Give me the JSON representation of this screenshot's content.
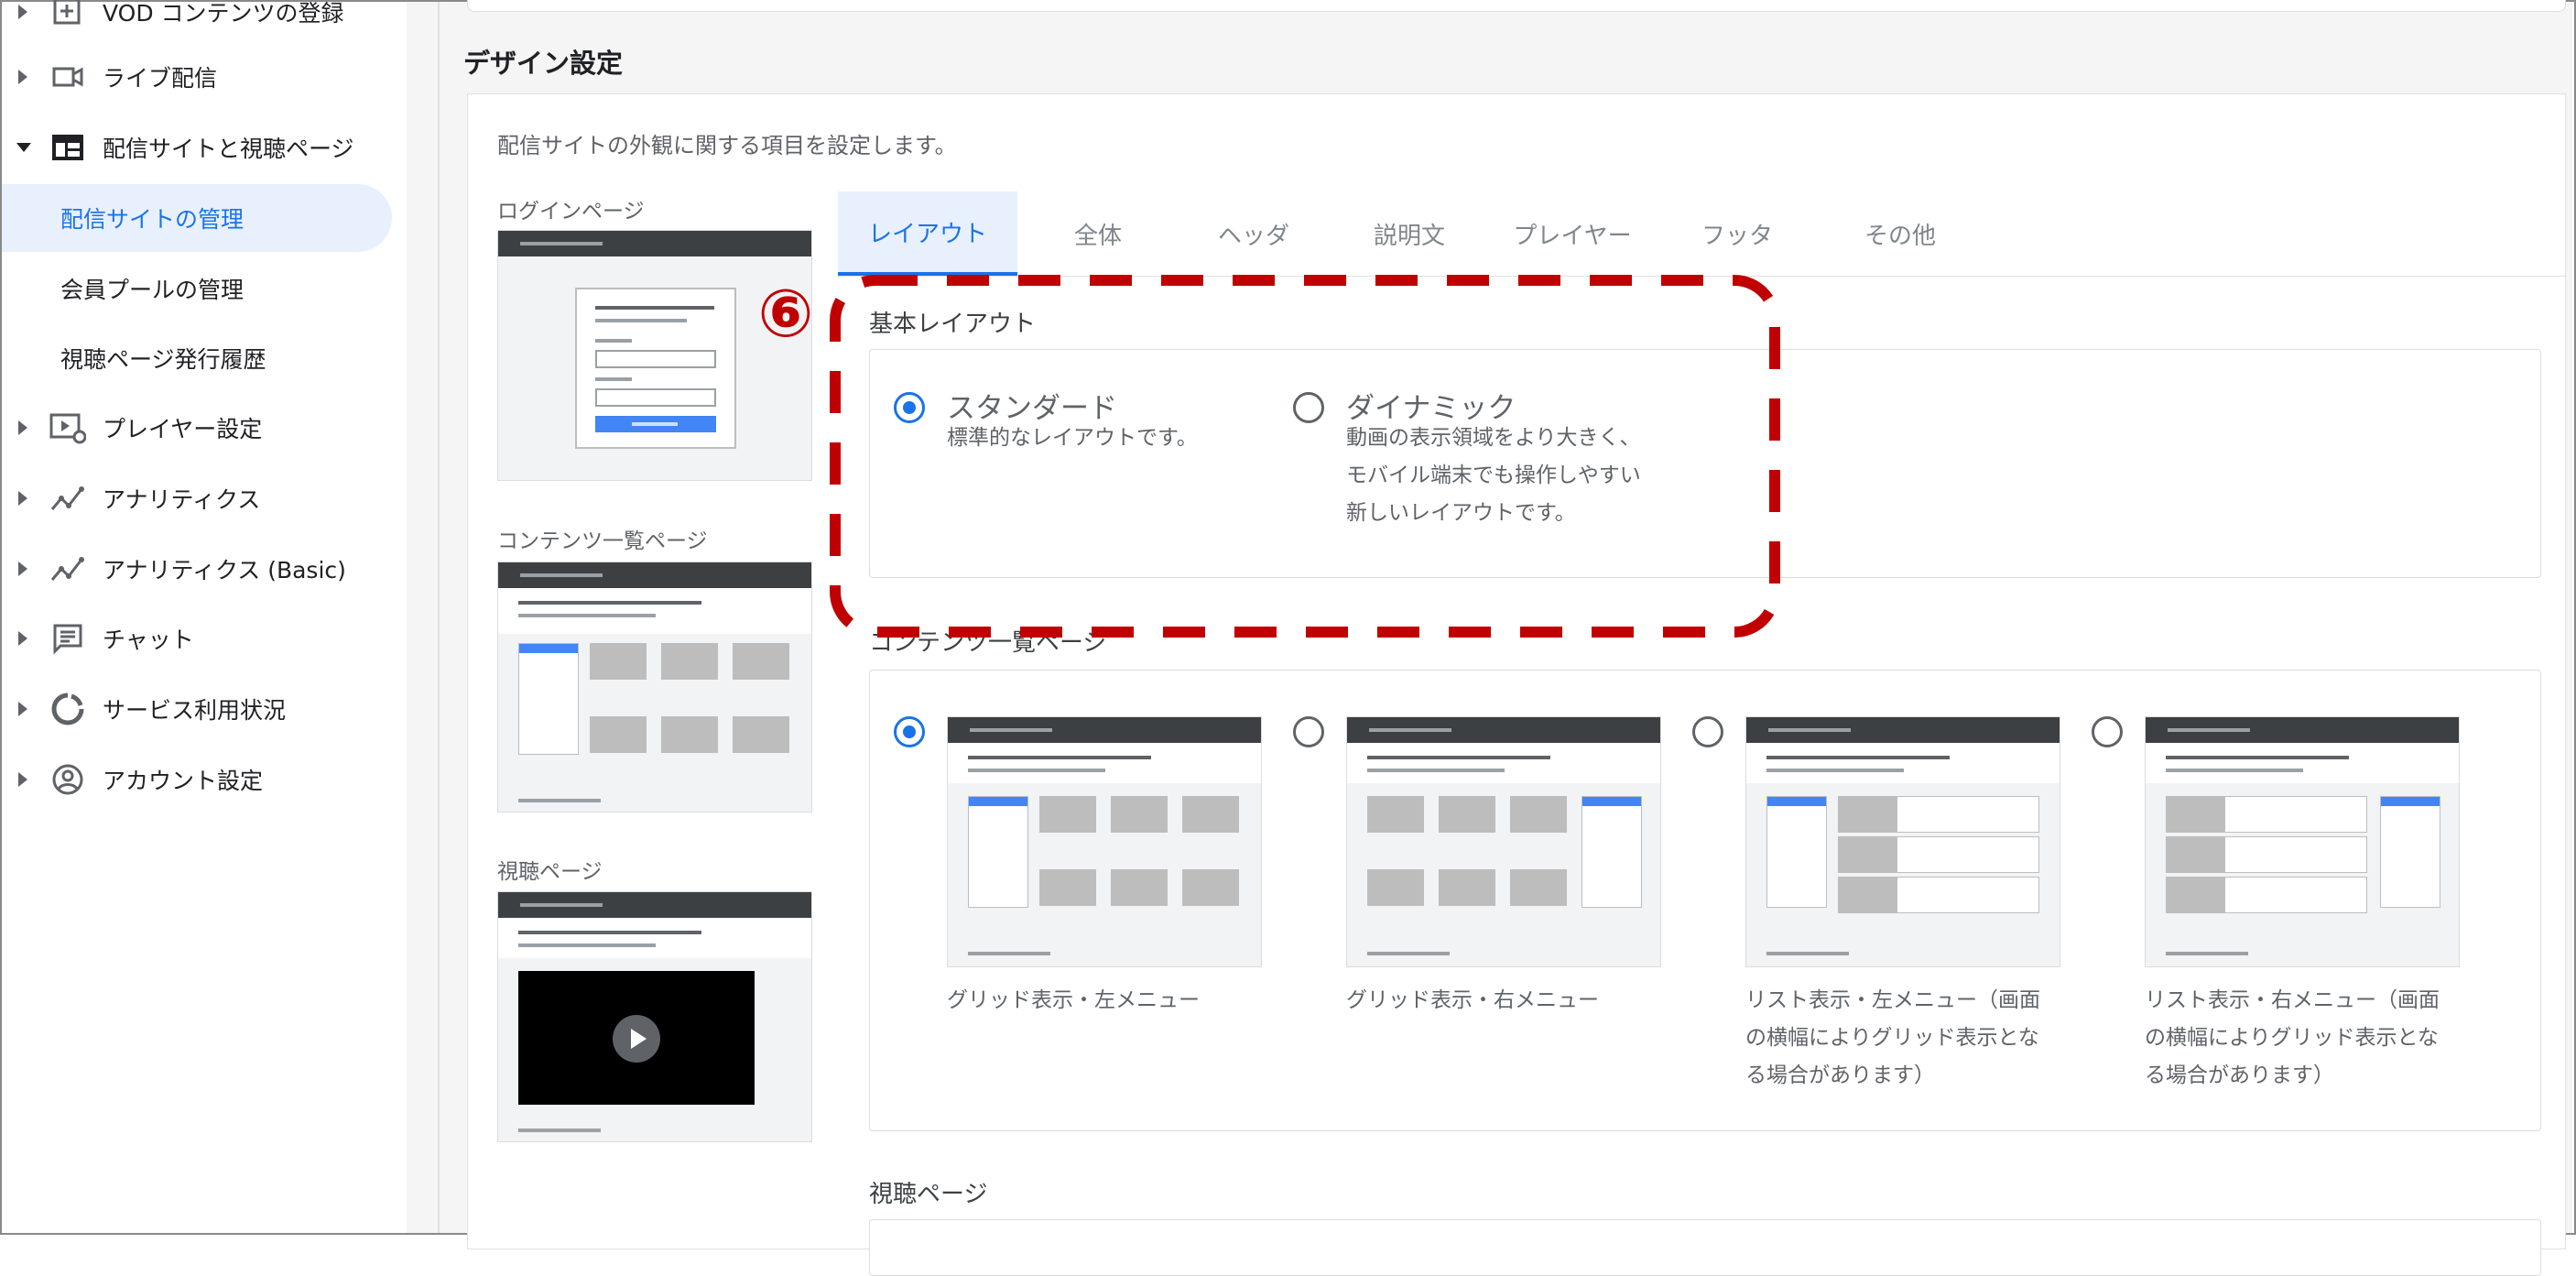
{
  "sidebar": {
    "items": [
      {
        "label": "VOD コンテンツの登録",
        "icon": "video-add-icon"
      },
      {
        "label": "ライブ配信",
        "icon": "videocam-icon"
      },
      {
        "label": "配信サイトと視聴ページ",
        "icon": "web-layout-icon"
      },
      {
        "label": "プレイヤー設定",
        "icon": "player-settings-icon"
      },
      {
        "label": "アナリティクス",
        "icon": "analytics-icon"
      },
      {
        "label": "アナリティクス (Basic)",
        "icon": "analytics-basic-icon"
      },
      {
        "label": "チャット",
        "icon": "chat-icon"
      },
      {
        "label": "サービス利用状況",
        "icon": "usage-icon"
      },
      {
        "label": "アカウント設定",
        "icon": "account-icon"
      }
    ],
    "subitems": [
      {
        "label": "配信サイトの管理",
        "active": true
      },
      {
        "label": "会員プールの管理",
        "active": false
      },
      {
        "label": "視聴ページ発行履歴",
        "active": false
      }
    ]
  },
  "main": {
    "section_title": "デザイン設定",
    "description": "配信サイトの外観に関する項目を設定します。",
    "previews": {
      "login": "ログインページ",
      "contents": "コンテンツ一覧ページ",
      "watch": "視聴ページ"
    },
    "tabs": [
      "レイアウト",
      "全体",
      "ヘッダ",
      "説明文",
      "プレイヤー",
      "フッタ",
      "その他"
    ],
    "active_tab": "レイアウト",
    "basic_layout": {
      "label": "基本レイアウト",
      "options": [
        {
          "title": "スタンダード",
          "desc": [
            "標準的なレイアウトです。"
          ],
          "selected": true
        },
        {
          "title": "ダイナミック",
          "desc": [
            "動画の表示領域をより大きく、",
            "モバイル端末でも操作しやすい",
            "新しいレイアウトです。"
          ],
          "selected": false
        }
      ]
    },
    "contents_list": {
      "label": "コンテンツ一覧ページ",
      "options": [
        {
          "caption": [
            "グリッド表示・左メニュー"
          ],
          "selected": true
        },
        {
          "caption": [
            "グリッド表示・右メニュー"
          ],
          "selected": false
        },
        {
          "caption": [
            "リスト表示・左メニュー（画面",
            "の横幅によりグリッド表示とな",
            "る場合があります）"
          ],
          "selected": false
        },
        {
          "caption": [
            "リスト表示・右メニュー（画面",
            "の横幅によりグリッド表示とな",
            "る場合があります）"
          ],
          "selected": false
        }
      ]
    },
    "watch_page_label": "視聴ページ",
    "annotation_number": "⑥"
  },
  "colors": {
    "accent": "#1a73e8",
    "annotation": "#c00000",
    "active_bg": "#e8f0fe"
  }
}
